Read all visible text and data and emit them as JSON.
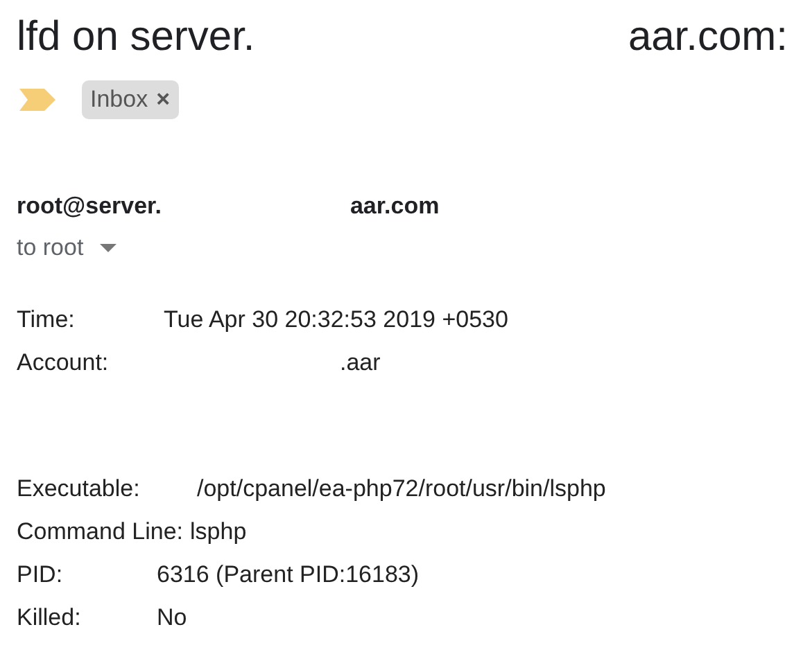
{
  "subject": {
    "parts": [
      "lfd on server.",
      "aar.com:"
    ]
  },
  "labels": [
    {
      "text": "Inbox",
      "remove": "×"
    }
  ],
  "important": true,
  "sender": {
    "parts": [
      "root@server.",
      "aar.com"
    ]
  },
  "recipient": "to root",
  "body": [
    [
      {
        "label": "Time:",
        "value": "Tue Apr 30 20:32:53 2019 +0530"
      },
      {
        "label": "Account:",
        "value": ".aar"
      }
    ],
    [
      {
        "label": "Executable:",
        "value": "/opt/cpanel/ea-php72/root/usr/bin/lsphp"
      },
      {
        "label": "Command Line:",
        "value": "lsphp"
      },
      {
        "label": "PID:",
        "value": "6316 (Parent PID:16183)"
      },
      {
        "label": "Killed:",
        "value": "No"
      }
    ]
  ]
}
